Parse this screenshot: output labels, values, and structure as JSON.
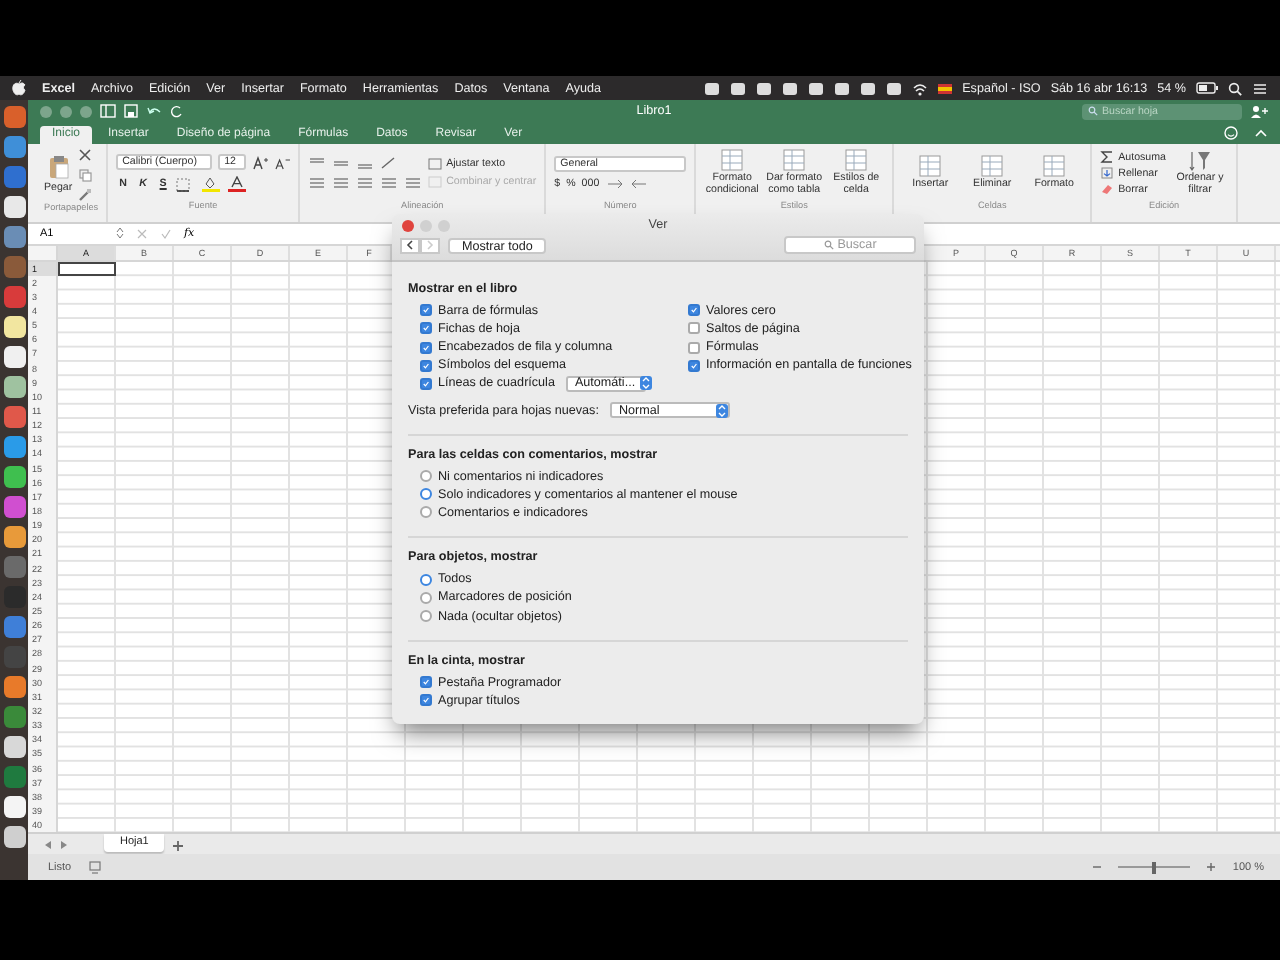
{
  "menu_bar": {
    "app": "Excel",
    "items": [
      "Archivo",
      "Edición",
      "Ver",
      "Insertar",
      "Formato",
      "Herramientas",
      "Datos",
      "Ventana",
      "Ayuda"
    ],
    "input_source": "Español - ISO",
    "clock": "Sáb 16 abr 16:13",
    "battery": "54 %"
  },
  "dock": {
    "icons": [
      {
        "color": "#d9602b"
      },
      {
        "color": "#3f8fd8"
      },
      {
        "color": "#2f6fcf"
      },
      {
        "color": "#e8e8e8"
      },
      {
        "color": "#6a8db5"
      },
      {
        "color": "#8a5a3a"
      },
      {
        "color": "#d83b3b"
      },
      {
        "color": "#f2e6a0"
      },
      {
        "color": "#f0f0f0"
      },
      {
        "color": "#9fc2a0"
      },
      {
        "color": "#e0584a"
      },
      {
        "color": "#2a9be8"
      },
      {
        "color": "#3fbf4f"
      },
      {
        "color": "#d04fd0"
      },
      {
        "color": "#e89a3a"
      },
      {
        "color": "#6a6a6a"
      },
      {
        "color": "#2b2b2b"
      },
      {
        "color": "#3f7fd8"
      },
      {
        "color": "#444444"
      },
      {
        "color": "#e87a2a"
      },
      {
        "color": "#3a8a3a"
      },
      {
        "color": "#d8d8d8"
      },
      {
        "color": "#1f7a3f"
      },
      {
        "color": "#f4f4f4"
      },
      {
        "color": "#cfcfcf"
      }
    ]
  },
  "title_bar": {
    "title": "Libro1",
    "search_placeholder": "Buscar hoja"
  },
  "ribbon_tabs": [
    {
      "label": "Inicio",
      "selected": true
    },
    {
      "label": "Insertar",
      "selected": false
    },
    {
      "label": "Diseño de página",
      "selected": false
    },
    {
      "label": "Fórmulas",
      "selected": false
    },
    {
      "label": "Datos",
      "selected": false
    },
    {
      "label": "Revisar",
      "selected": false
    },
    {
      "label": "Ver",
      "selected": false
    }
  ],
  "ribbon": {
    "groups": [
      {
        "kind": "clipboard",
        "label": "Portapapeles",
        "paste": "Pegar"
      },
      {
        "kind": "font",
        "label": "Fuente",
        "font": "Calibri (Cuerpo)",
        "size": "12",
        "styles": [
          "N",
          "K",
          "S"
        ]
      },
      {
        "kind": "alignment",
        "label": "Alineación",
        "wrap": "Ajustar texto",
        "merge": {
          "label": "Combinar y centrar",
          "disabled": true
        }
      },
      {
        "kind": "number",
        "label": "Número",
        "format": "General",
        "symbols": [
          "$",
          "%",
          "000"
        ]
      },
      {
        "kind": "big",
        "label": "Estilos",
        "buttons": [
          "Formato condicional",
          "Dar formato como tabla",
          "Estilos de celda"
        ]
      },
      {
        "kind": "big",
        "label": "Celdas",
        "buttons": [
          "Insertar",
          "Eliminar",
          "Formato"
        ]
      },
      {
        "kind": "editing",
        "label": "Edición",
        "commands": [
          "Autosuma",
          "Rellenar",
          "Borrar"
        ],
        "sort": "Ordenar y filtrar"
      }
    ]
  },
  "formula_bar": {
    "name_box": "A1",
    "function_label": "fx"
  },
  "grid": {
    "columns_left": [
      {
        "label": "A",
        "selected": true
      },
      {
        "label": "B",
        "selected": false
      },
      {
        "label": "C",
        "selected": false
      },
      {
        "label": "D",
        "selected": false
      },
      {
        "label": "E",
        "selected": false
      },
      {
        "label": "F",
        "selected": false
      }
    ],
    "columns_right": [
      {
        "label": "P",
        "selected": false
      },
      {
        "label": "Q",
        "selected": false
      },
      {
        "label": "R",
        "selected": false
      },
      {
        "label": "S",
        "selected": false
      },
      {
        "label": "T",
        "selected": false
      },
      {
        "label": "U",
        "selected": false
      }
    ],
    "rows": [
      {
        "label": "1",
        "selected": true
      },
      {
        "label": "2",
        "selected": false
      },
      {
        "label": "3",
        "selected": false
      },
      {
        "label": "4",
        "selected": false
      },
      {
        "label": "5",
        "selected": false
      },
      {
        "label": "6",
        "selected": false
      },
      {
        "label": "7",
        "selected": false
      },
      {
        "label": "8",
        "selected": false
      },
      {
        "label": "9",
        "selected": false
      },
      {
        "label": "10",
        "selected": false
      },
      {
        "label": "11",
        "selected": false
      },
      {
        "label": "12",
        "selected": false
      },
      {
        "label": "13",
        "selected": false
      },
      {
        "label": "14",
        "selected": false
      },
      {
        "label": "15",
        "selected": false
      },
      {
        "label": "16",
        "selected": false
      },
      {
        "label": "17",
        "selected": false
      },
      {
        "label": "18",
        "selected": false
      },
      {
        "label": "19",
        "selected": false
      },
      {
        "label": "20",
        "selected": false
      },
      {
        "label": "21",
        "selected": false
      },
      {
        "label": "22",
        "selected": false
      },
      {
        "label": "23",
        "selected": false
      },
      {
        "label": "24",
        "selected": false
      },
      {
        "label": "25",
        "selected": false
      },
      {
        "label": "26",
        "selected": false
      },
      {
        "label": "27",
        "selected": false
      },
      {
        "label": "28",
        "selected": false
      },
      {
        "label": "29",
        "selected": false
      },
      {
        "label": "30",
        "selected": false
      },
      {
        "label": "31",
        "selected": false
      },
      {
        "label": "32",
        "selected": false
      },
      {
        "label": "33",
        "selected": false
      },
      {
        "label": "34",
        "selected": false
      },
      {
        "label": "35",
        "selected": false
      },
      {
        "label": "36",
        "selected": false
      },
      {
        "label": "37",
        "selected": false
      },
      {
        "label": "38",
        "selected": false
      },
      {
        "label": "39",
        "selected": false
      },
      {
        "label": "40",
        "selected": false
      }
    ]
  },
  "sheet_tabs": [
    {
      "label": "Hoja1",
      "selected": true
    }
  ],
  "status_bar": {
    "status": "Listo",
    "zoom": "100 %",
    "zoom_slider": {
      "level": 0.5
    }
  },
  "dialog": {
    "title": "Ver",
    "show_all": "Mostrar todo",
    "search_placeholder": "Buscar",
    "sections": [
      {
        "heading": "Mostrar en el libro",
        "columns": [
          [
            {
              "kind": "checkbox",
              "label": "Barra de fórmulas",
              "checked": true
            },
            {
              "kind": "checkbox",
              "label": "Fichas de hoja",
              "checked": true
            },
            {
              "kind": "checkbox",
              "label": "Encabezados de fila y columna",
              "checked": true
            },
            {
              "kind": "checkbox",
              "label": "Símbolos del esquema",
              "checked": true
            },
            {
              "kind": "checkbox_select",
              "label": "Líneas de cuadrícula",
              "checked": true,
              "value": "Automáti..."
            }
          ],
          [
            {
              "kind": "checkbox",
              "label": "Valores cero",
              "checked": true
            },
            {
              "kind": "checkbox",
              "label": "Saltos de página",
              "checked": false
            },
            {
              "kind": "checkbox",
              "label": "Fórmulas",
              "checked": false
            },
            {
              "kind": "checkbox",
              "label": "Información en pantalla de funciones",
              "checked": true
            }
          ]
        ],
        "items": [
          {
            "kind": "select",
            "label": "Vista preferida para hojas nuevas:",
            "value": "Normal"
          }
        ]
      },
      {
        "heading": "Para las celdas con comentarios, mostrar",
        "items": [
          {
            "kind": "radio",
            "label": "Ni comentarios ni indicadores",
            "selected": false
          },
          {
            "kind": "radio",
            "label": "Solo indicadores y comentarios al mantener el mouse",
            "selected": true
          },
          {
            "kind": "radio",
            "label": "Comentarios e indicadores",
            "selected": false
          }
        ]
      },
      {
        "heading": "Para objetos, mostrar",
        "items": [
          {
            "kind": "radio",
            "label": "Todos",
            "selected": true
          },
          {
            "kind": "radio",
            "label": "Marcadores de posición",
            "selected": false
          },
          {
            "kind": "radio",
            "label": "Nada (ocultar objetos)",
            "selected": false
          }
        ]
      },
      {
        "heading": "En la cinta, mostrar",
        "items": [
          {
            "kind": "checkbox",
            "label": "Pestaña Programador",
            "checked": true
          },
          {
            "kind": "checkbox",
            "label": "Agrupar títulos",
            "checked": true
          }
        ]
      }
    ]
  }
}
